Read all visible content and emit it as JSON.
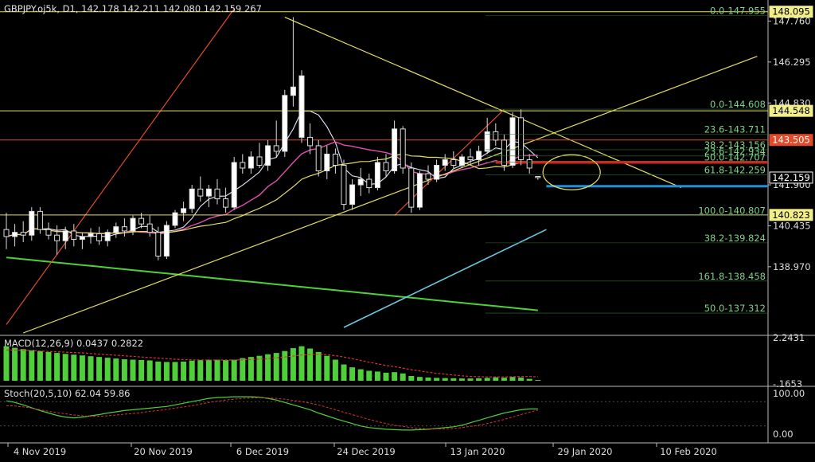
{
  "main_header": "GBPJPY.oj5k, D1, 142.178 142.211 142.080 142.159 267",
  "macd_header": "MACD(12,26,9) 0.0437 0.2822",
  "stoch_header": "Stoch(20,5,10) 62.04 59.86",
  "colors": {
    "background": "#000000",
    "bull_candle": "#ffffff",
    "bear_candle": "#000000",
    "fib_text": "#7fd48a",
    "yellow_line": "#e8e062",
    "red_line": "#e24a2a",
    "blue_line": "#1e90d8",
    "green_ma": "#4fcf3a",
    "pink_ma": "#e050b0",
    "cyan_line": "#6cc8e0",
    "macd_hist": "#4fcf3a",
    "macd_signal": "#e03030"
  },
  "chart_data": [
    {
      "type": "candlestick",
      "symbol": "GBPJPY.oj5k",
      "timeframe": "D1",
      "ohlc_current": {
        "open": 142.178,
        "high": 142.211,
        "low": 142.08,
        "close": 142.159,
        "volume": 267
      },
      "x_tick_labels": [
        "4 Nov 2019",
        "20 Nov 2019",
        "6 Dec 2019",
        "24 Dec 2019",
        "13 Jan 2020",
        "29 Jan 2020",
        "10 Feb 2020"
      ],
      "y_tick_labels": [
        "147.760",
        "146.295",
        "144.830",
        "141.900",
        "140.435",
        "138.970"
      ],
      "ylim": [
        136.6,
        148.4
      ],
      "price_labels": [
        {
          "label": "148.095",
          "value": 148.095,
          "style": "yellow"
        },
        {
          "label": "144.548",
          "value": 144.548,
          "style": "yellow"
        },
        {
          "label": "143.505",
          "value": 143.505,
          "style": "red"
        },
        {
          "label": "142.159",
          "value": 142.159,
          "style": "white"
        },
        {
          "label": "140.823",
          "value": 140.823,
          "style": "yellow"
        }
      ],
      "fib_levels": [
        {
          "label": "0.0-147.955",
          "value": 147.955
        },
        {
          "label": "0.0-144.608",
          "value": 144.608
        },
        {
          "label": "23.6-143.711",
          "value": 143.711
        },
        {
          "label": "38.2-143.156",
          "value": 143.156
        },
        {
          "label": "23.6-142.934",
          "value": 142.934
        },
        {
          "label": "50.0-142.707",
          "value": 142.707
        },
        {
          "label": "61.8-142.259",
          "value": 142.259
        },
        {
          "label": "100.0-140.807",
          "value": 140.807
        },
        {
          "label": "38.2-139.824",
          "value": 139.824
        },
        {
          "label": "161.8-138.458",
          "value": 138.458
        },
        {
          "label": "50.0-137.312",
          "value": 137.312
        }
      ],
      "candles": [
        {
          "o": 140.3,
          "h": 140.9,
          "l": 139.6,
          "c": 140.05
        },
        {
          "o": 140.05,
          "h": 140.5,
          "l": 139.7,
          "c": 140.2
        },
        {
          "o": 140.2,
          "h": 140.6,
          "l": 139.85,
          "c": 140.1
        },
        {
          "o": 140.1,
          "h": 141.1,
          "l": 139.9,
          "c": 140.95
        },
        {
          "o": 140.95,
          "h": 141.1,
          "l": 140.15,
          "c": 140.3
        },
        {
          "o": 140.3,
          "h": 140.55,
          "l": 139.95,
          "c": 140.1
        },
        {
          "o": 140.1,
          "h": 140.45,
          "l": 139.4,
          "c": 139.9
        },
        {
          "o": 139.9,
          "h": 140.4,
          "l": 139.6,
          "c": 140.25
        },
        {
          "o": 140.25,
          "h": 140.5,
          "l": 139.7,
          "c": 139.95
        },
        {
          "o": 139.95,
          "h": 140.2,
          "l": 139.6,
          "c": 140.05
        },
        {
          "o": 140.05,
          "h": 140.35,
          "l": 139.8,
          "c": 140.15
        },
        {
          "o": 140.15,
          "h": 140.4,
          "l": 139.75,
          "c": 139.9
        },
        {
          "o": 139.9,
          "h": 140.3,
          "l": 139.7,
          "c": 140.2
        },
        {
          "o": 140.2,
          "h": 140.55,
          "l": 140.0,
          "c": 140.4
        },
        {
          "o": 140.4,
          "h": 140.7,
          "l": 140.05,
          "c": 140.25
        },
        {
          "o": 140.25,
          "h": 140.8,
          "l": 140.1,
          "c": 140.7
        },
        {
          "o": 140.7,
          "h": 140.9,
          "l": 140.35,
          "c": 140.5
        },
        {
          "o": 140.5,
          "h": 140.8,
          "l": 140.05,
          "c": 140.2
        },
        {
          "o": 140.2,
          "h": 140.4,
          "l": 139.2,
          "c": 139.35
        },
        {
          "o": 139.35,
          "h": 140.6,
          "l": 139.25,
          "c": 140.45
        },
        {
          "o": 140.45,
          "h": 141.0,
          "l": 140.35,
          "c": 140.9
        },
        {
          "o": 140.9,
          "h": 141.3,
          "l": 140.6,
          "c": 141.05
        },
        {
          "o": 141.05,
          "h": 141.9,
          "l": 140.9,
          "c": 141.75
        },
        {
          "o": 141.75,
          "h": 142.2,
          "l": 141.3,
          "c": 141.5
        },
        {
          "o": 141.5,
          "h": 141.9,
          "l": 141.1,
          "c": 141.75
        },
        {
          "o": 141.75,
          "h": 142.1,
          "l": 141.2,
          "c": 141.4
        },
        {
          "o": 141.4,
          "h": 141.8,
          "l": 140.9,
          "c": 141.1
        },
        {
          "o": 141.1,
          "h": 142.9,
          "l": 141.0,
          "c": 142.7
        },
        {
          "o": 142.7,
          "h": 143.0,
          "l": 142.3,
          "c": 142.5
        },
        {
          "o": 142.5,
          "h": 143.1,
          "l": 142.3,
          "c": 142.9
        },
        {
          "o": 142.9,
          "h": 143.4,
          "l": 142.5,
          "c": 142.6
        },
        {
          "o": 142.6,
          "h": 143.5,
          "l": 142.4,
          "c": 143.3
        },
        {
          "o": 143.3,
          "h": 144.2,
          "l": 142.9,
          "c": 143.1
        },
        {
          "o": 143.1,
          "h": 145.3,
          "l": 142.9,
          "c": 145.1
        },
        {
          "o": 145.1,
          "h": 147.9,
          "l": 144.7,
          "c": 145.4
        },
        {
          "o": 143.6,
          "h": 146.0,
          "l": 143.4,
          "c": 145.8
        },
        {
          "o": 143.6,
          "h": 144.1,
          "l": 143.0,
          "c": 143.3
        },
        {
          "o": 143.3,
          "h": 143.5,
          "l": 142.2,
          "c": 142.4
        },
        {
          "o": 142.4,
          "h": 143.3,
          "l": 142.1,
          "c": 143.0
        },
        {
          "o": 143.0,
          "h": 143.2,
          "l": 142.3,
          "c": 142.6
        },
        {
          "o": 142.6,
          "h": 142.8,
          "l": 141.0,
          "c": 141.2
        },
        {
          "o": 141.2,
          "h": 142.1,
          "l": 141.0,
          "c": 141.9
        },
        {
          "o": 141.9,
          "h": 142.5,
          "l": 141.5,
          "c": 142.1
        },
        {
          "o": 142.1,
          "h": 142.3,
          "l": 141.6,
          "c": 141.8
        },
        {
          "o": 141.8,
          "h": 142.9,
          "l": 141.7,
          "c": 142.7
        },
        {
          "o": 142.7,
          "h": 143.0,
          "l": 142.2,
          "c": 142.4
        },
        {
          "o": 142.4,
          "h": 144.2,
          "l": 142.3,
          "c": 143.9
        },
        {
          "o": 143.9,
          "h": 144.0,
          "l": 142.3,
          "c": 142.5
        },
        {
          "o": 142.5,
          "h": 142.7,
          "l": 140.9,
          "c": 141.1
        },
        {
          "o": 141.1,
          "h": 142.4,
          "l": 141.0,
          "c": 142.3
        },
        {
          "o": 142.3,
          "h": 142.6,
          "l": 141.9,
          "c": 142.1
        },
        {
          "o": 142.1,
          "h": 142.8,
          "l": 142.0,
          "c": 142.6
        },
        {
          "o": 142.6,
          "h": 143.0,
          "l": 142.4,
          "c": 142.8
        },
        {
          "o": 142.8,
          "h": 143.1,
          "l": 142.5,
          "c": 142.6
        },
        {
          "o": 142.6,
          "h": 143.0,
          "l": 142.5,
          "c": 142.9
        },
        {
          "o": 142.9,
          "h": 143.2,
          "l": 142.6,
          "c": 142.8
        },
        {
          "o": 142.8,
          "h": 143.3,
          "l": 142.6,
          "c": 143.1
        },
        {
          "o": 143.1,
          "h": 144.3,
          "l": 143.0,
          "c": 143.8
        },
        {
          "o": 143.8,
          "h": 144.1,
          "l": 143.3,
          "c": 143.5
        },
        {
          "o": 143.5,
          "h": 143.7,
          "l": 142.4,
          "c": 142.6
        },
        {
          "o": 142.6,
          "h": 144.5,
          "l": 142.5,
          "c": 144.3
        },
        {
          "o": 144.3,
          "h": 144.6,
          "l": 142.6,
          "c": 142.8
        },
        {
          "o": 142.8,
          "h": 143.0,
          "l": 142.3,
          "c": 142.5
        },
        {
          "o": 142.2,
          "h": 142.21,
          "l": 142.08,
          "c": 142.159
        }
      ]
    },
    {
      "type": "bar",
      "name": "MACD(12,26,9)",
      "header_values": [
        0.0437,
        0.2822
      ],
      "y_tick_labels": [
        "2.2431",
        "-.1653"
      ],
      "histogram": [
        1.8,
        1.72,
        1.65,
        1.6,
        1.55,
        1.5,
        1.45,
        1.4,
        1.36,
        1.32,
        1.28,
        1.24,
        1.2,
        1.16,
        1.12,
        1.1,
        1.08,
        1.06,
        1.0,
        0.98,
        0.98,
        1.0,
        1.05,
        1.08,
        1.1,
        1.1,
        1.08,
        1.1,
        1.18,
        1.24,
        1.3,
        1.38,
        1.45,
        1.55,
        1.7,
        1.8,
        1.68,
        1.5,
        1.3,
        1.1,
        0.85,
        0.7,
        0.6,
        0.52,
        0.48,
        0.42,
        0.45,
        0.38,
        0.25,
        0.2,
        0.17,
        0.15,
        0.14,
        0.13,
        0.12,
        0.12,
        0.13,
        0.15,
        0.18,
        0.16,
        0.2,
        0.17,
        0.1,
        0.04
      ],
      "signal": [
        1.6,
        1.6,
        1.59,
        1.57,
        1.55,
        1.53,
        1.51,
        1.49,
        1.47,
        1.45,
        1.42,
        1.39,
        1.36,
        1.33,
        1.3,
        1.27,
        1.24,
        1.21,
        1.18,
        1.15,
        1.12,
        1.1,
        1.09,
        1.08,
        1.08,
        1.08,
        1.08,
        1.08,
        1.09,
        1.11,
        1.13,
        1.16,
        1.2,
        1.24,
        1.29,
        1.34,
        1.37,
        1.38,
        1.36,
        1.31,
        1.24,
        1.15,
        1.06,
        0.97,
        0.88,
        0.8,
        0.73,
        0.66,
        0.58,
        0.51,
        0.45,
        0.39,
        0.34,
        0.3,
        0.26,
        0.23,
        0.21,
        0.2,
        0.2,
        0.2,
        0.21,
        0.22,
        0.22,
        0.21
      ]
    },
    {
      "type": "line",
      "name": "Stoch(20,5,10)",
      "header_values": [
        62.04,
        59.86
      ],
      "y_tick_labels": [
        "100.00",
        "0.00"
      ],
      "main": [
        82,
        78,
        72,
        65,
        58,
        52,
        46,
        42,
        40,
        42,
        45,
        48,
        52,
        55,
        58,
        60,
        62,
        64,
        66,
        68,
        72,
        76,
        80,
        84,
        88,
        90,
        91,
        92,
        92,
        92,
        91,
        88,
        84,
        78,
        72,
        66,
        60,
        52,
        45,
        38,
        32,
        26,
        20,
        16,
        14,
        12,
        11,
        10,
        10,
        11,
        12,
        14,
        16,
        18,
        22,
        28,
        34,
        40,
        46,
        52,
        56,
        60,
        62,
        62
      ],
      "signal": [
        70,
        69,
        67,
        64,
        60,
        56,
        53,
        50,
        47,
        45,
        44,
        44,
        45,
        47,
        49,
        51,
        53,
        56,
        58,
        61,
        64,
        67,
        70,
        74,
        78,
        81,
        84,
        86,
        88,
        89,
        90,
        89,
        88,
        86,
        83,
        80,
        76,
        72,
        66,
        60,
        54,
        48,
        42,
        36,
        31,
        26,
        22,
        19,
        16,
        14,
        13,
        13,
        13,
        14,
        16,
        19,
        22,
        26,
        31,
        36,
        42,
        48,
        54,
        59
      ]
    }
  ]
}
